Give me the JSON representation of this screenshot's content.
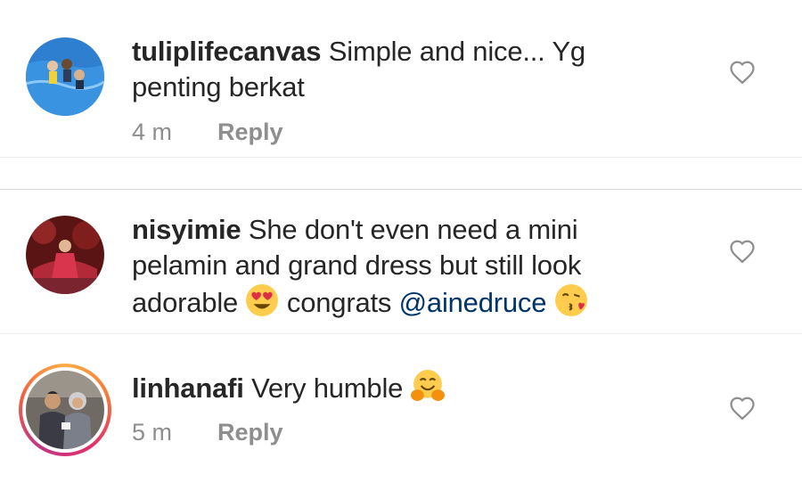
{
  "comments": [
    {
      "username": "tuliplifecanvas",
      "text_line1": "Simple and nice... Yg",
      "text_line2": "penting berkat",
      "time": "4 m",
      "reply": "Reply"
    },
    {
      "username": "nisyimie",
      "text_line1": "She don't even need a mini",
      "text_line2": "pelamin and grand dress but still look",
      "text_line3a": "adorable",
      "text_line3b": "congrats",
      "mention": "@ainedruce"
    },
    {
      "username": "linhanafi",
      "text": "Very humble",
      "time": "5 m",
      "reply": "Reply"
    }
  ],
  "icons": {
    "like": "heart-outline-icon",
    "emoji_heart_eyes": "heart-eyes-emoji",
    "emoji_kiss": "kissing-face-emoji",
    "emoji_hug": "hugging-face-emoji"
  },
  "colors": {
    "text": "#262626",
    "muted": "#8e8e8e",
    "mention": "#003569",
    "divider": "#dbdbdb"
  }
}
